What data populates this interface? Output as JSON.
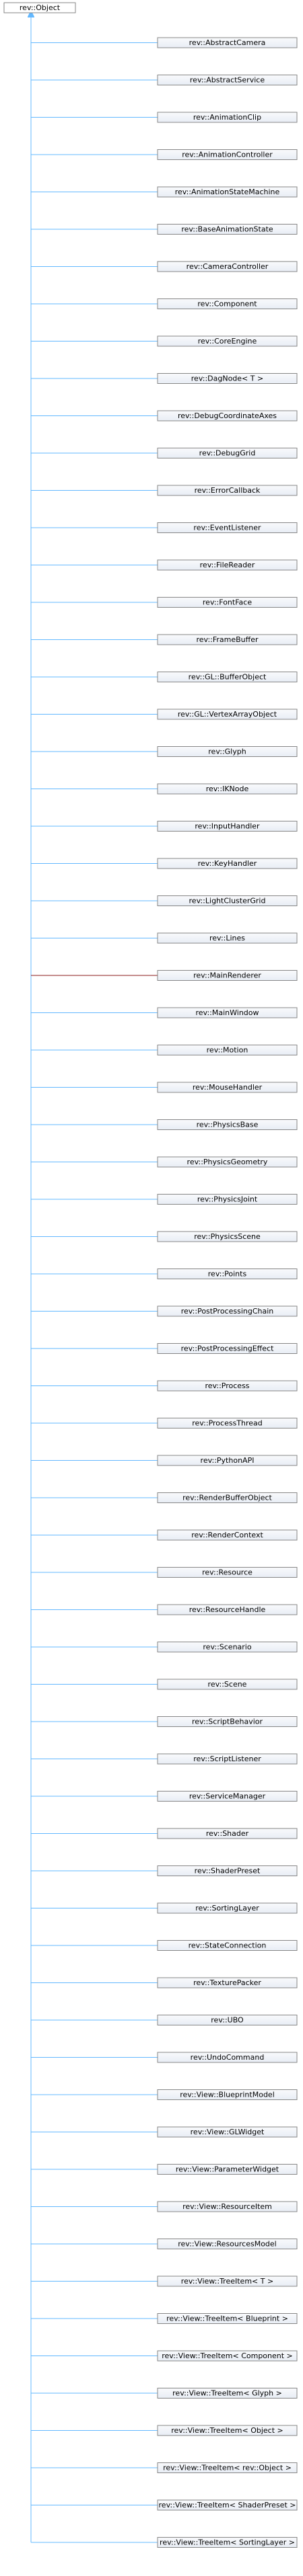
{
  "root": {
    "label": "rev::Object"
  },
  "children": [
    {
      "label": "rev::AbstractCamera"
    },
    {
      "label": "rev::AbstractService"
    },
    {
      "label": "rev::AnimationClip"
    },
    {
      "label": "rev::AnimationController"
    },
    {
      "label": "rev::AnimationStateMachine"
    },
    {
      "label": "rev::BaseAnimationState"
    },
    {
      "label": "rev::CameraController"
    },
    {
      "label": "rev::Component"
    },
    {
      "label": "rev::CoreEngine"
    },
    {
      "label": "rev::DagNode< T >"
    },
    {
      "label": "rev::DebugCoordinateAxes"
    },
    {
      "label": "rev::DebugGrid"
    },
    {
      "label": "rev::ErrorCallback"
    },
    {
      "label": "rev::EventListener"
    },
    {
      "label": "rev::FileReader"
    },
    {
      "label": "rev::FontFace"
    },
    {
      "label": "rev::FrameBuffer"
    },
    {
      "label": "rev::GL::BufferObject"
    },
    {
      "label": "rev::GL::VertexArrayObject"
    },
    {
      "label": "rev::Glyph"
    },
    {
      "label": "rev::IKNode"
    },
    {
      "label": "rev::InputHandler"
    },
    {
      "label": "rev::KeyHandler"
    },
    {
      "label": "rev::LightClusterGrid"
    },
    {
      "label": "rev::Lines"
    },
    {
      "label": "rev::MainRenderer",
      "edge": "dark"
    },
    {
      "label": "rev::MainWindow"
    },
    {
      "label": "rev::Motion"
    },
    {
      "label": "rev::MouseHandler"
    },
    {
      "label": "rev::PhysicsBase"
    },
    {
      "label": "rev::PhysicsGeometry"
    },
    {
      "label": "rev::PhysicsJoint"
    },
    {
      "label": "rev::PhysicsScene"
    },
    {
      "label": "rev::Points"
    },
    {
      "label": "rev::PostProcessingChain"
    },
    {
      "label": "rev::PostProcessingEffect"
    },
    {
      "label": "rev::Process"
    },
    {
      "label": "rev::ProcessThread"
    },
    {
      "label": "rev::PythonAPI"
    },
    {
      "label": "rev::RenderBufferObject"
    },
    {
      "label": "rev::RenderContext"
    },
    {
      "label": "rev::Resource"
    },
    {
      "label": "rev::ResourceHandle"
    },
    {
      "label": "rev::Scenario"
    },
    {
      "label": "rev::Scene"
    },
    {
      "label": "rev::ScriptBehavior"
    },
    {
      "label": "rev::ScriptListener"
    },
    {
      "label": "rev::ServiceManager"
    },
    {
      "label": "rev::Shader"
    },
    {
      "label": "rev::ShaderPreset"
    },
    {
      "label": "rev::SortingLayer"
    },
    {
      "label": "rev::StateConnection"
    },
    {
      "label": "rev::TexturePacker"
    },
    {
      "label": "rev::UBO"
    },
    {
      "label": "rev::UndoCommand"
    },
    {
      "label": "rev::View::BlueprintModel"
    },
    {
      "label": "rev::View::GLWidget"
    },
    {
      "label": "rev::View::ParameterWidget"
    },
    {
      "label": "rev::View::ResourceItem"
    },
    {
      "label": "rev::View::ResourcesModel"
    },
    {
      "label": "rev::View::TreeItem< T >"
    },
    {
      "label": "rev::View::TreeItem< Blueprint >"
    },
    {
      "label": "rev::View::TreeItem< Component >"
    },
    {
      "label": "rev::View::TreeItem< Glyph >"
    },
    {
      "label": "rev::View::TreeItem< Object >"
    },
    {
      "label": "rev::View::TreeItem< rev::Object >"
    },
    {
      "label": "rev::View::TreeItem< ShaderPreset >"
    },
    {
      "label": "rev::View::TreeItem< SortingLayer >"
    }
  ],
  "colors": {
    "root_fill": "#ffffff",
    "child_fill_top": "#f9fafc",
    "child_fill_bottom": "#e8edf5",
    "border": "#868686",
    "edge": "#63b8ff",
    "edge_dark": "#8b1a1a"
  }
}
